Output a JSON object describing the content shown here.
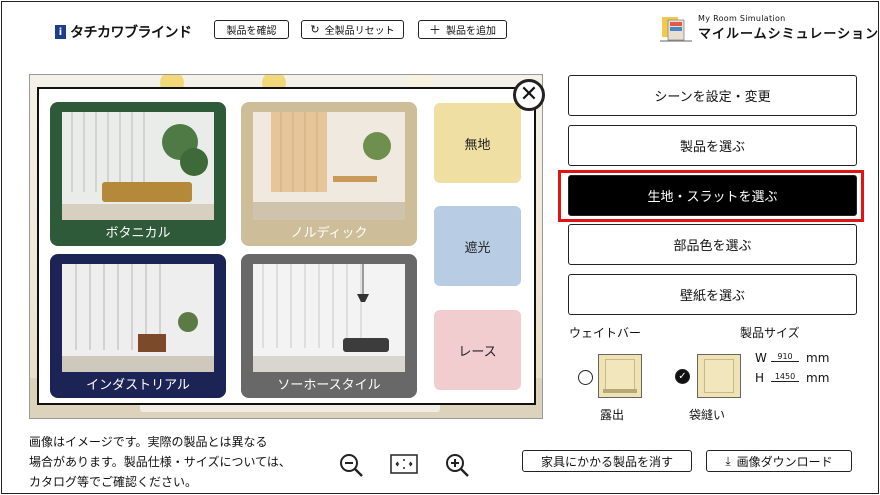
{
  "header": {
    "logo_text": "タチカワブラインド",
    "buttons": {
      "confirm": "製品を確認",
      "reset": "全製品リセット",
      "add": "製品を追加"
    },
    "brand_sub": "My Room Simulation",
    "brand_title": "マイルームシミュレーション"
  },
  "modal": {
    "cards": [
      {
        "label": "ボタニカル",
        "color": "#2f5a3a"
      },
      {
        "label": "ノルディック",
        "color": "#cdbd98"
      },
      {
        "label": "インダストリアル",
        "color": "#1c2455"
      },
      {
        "label": "ソーホースタイル",
        "color": "#686868"
      }
    ],
    "swatches": [
      {
        "label": "無地",
        "color": "#f0dfa3"
      },
      {
        "label": "遮光",
        "color": "#b8cde3"
      },
      {
        "label": "レース",
        "color": "#f2cdd0"
      }
    ]
  },
  "menu": {
    "scene": "シーンを設定・変更",
    "product": "製品を選ぶ",
    "fabric": "生地・スラットを選ぶ",
    "parts_color": "部品色を選ぶ",
    "wallpaper": "壁紙を選ぶ"
  },
  "options": {
    "weight_bar_label": "ウェイトバー",
    "size_label": "製品サイズ",
    "exposed_label": "露出",
    "sewn_label": "袋縫い",
    "width_prefix": "W",
    "width_value": "910",
    "height_prefix": "H",
    "height_value": "1450",
    "unit": "mm"
  },
  "footer": {
    "note_line1": "画像はイメージです。実際の製品とは異なる",
    "note_line2": "場合があります。製品仕様・サイズについては、",
    "note_line3": "カタログ等でご確認ください。",
    "clear_furniture": "家具にかかる製品を消す",
    "download": "画像ダウンロード"
  },
  "colors": {
    "accent_red": "#e11414",
    "active_button": "#000000"
  }
}
